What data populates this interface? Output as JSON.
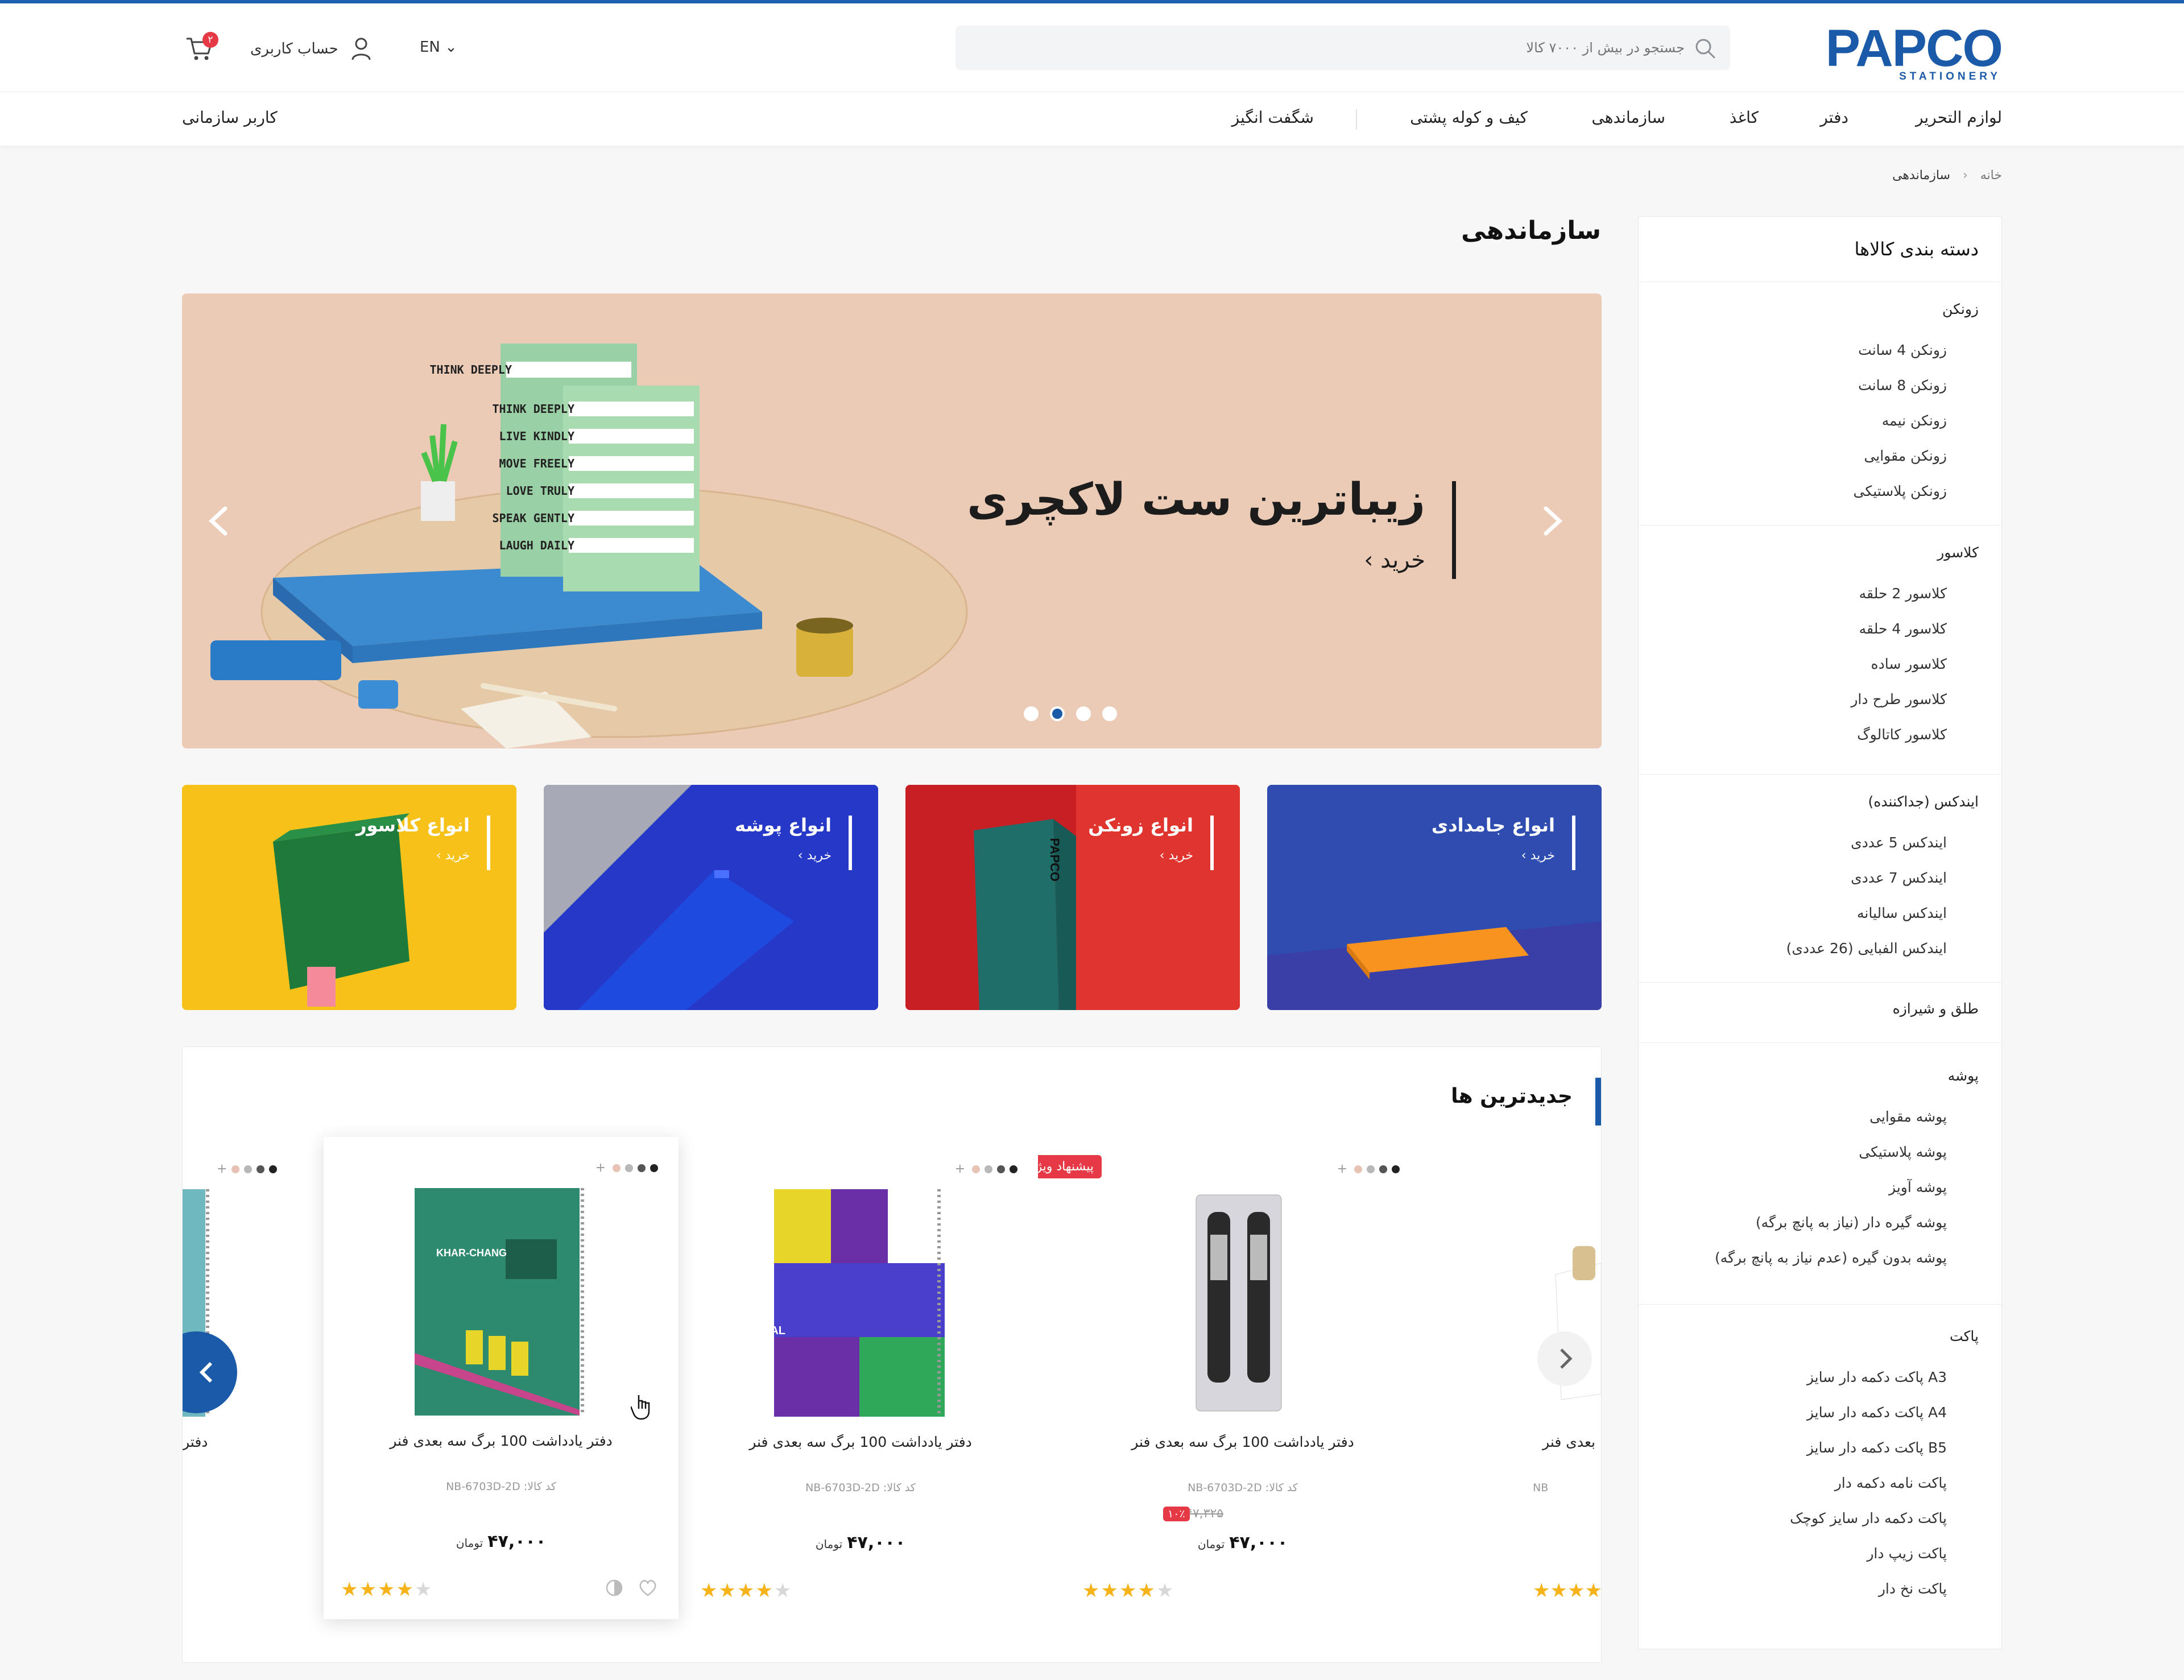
{
  "brand": {
    "name": "PAPCO",
    "tagline": "STATIONERY",
    "color": "#1b5aa8"
  },
  "header": {
    "search_placeholder": "جستجو در بیش از ۷۰۰۰ کالا",
    "lang": "EN ⌄",
    "account": "حساب کاربری",
    "cart_count": "۲"
  },
  "nav": {
    "items": [
      "لوازم التحریر",
      "دفتر",
      "کاغذ",
      "سازماندهی",
      "کیف و کوله پشتی",
      "شگفت انگیز"
    ],
    "org_user": "کاربر سازمانی"
  },
  "breadcrumb": {
    "home": "خانه",
    "current": "سازماندهی"
  },
  "page": {
    "title": "سازماندهی"
  },
  "sidebar": {
    "title": "دسته بندی کالاها",
    "groups": [
      {
        "name": "زونکن",
        "items": [
          "زونکن 4 سانت",
          "زونکن 8 سانت",
          "زونکن نیمه",
          "زونکن مقوایی",
          "زونکن پلاستیکی"
        ]
      },
      {
        "name": "کلاسور",
        "items": [
          "کلاسور 2 حلقه",
          "کلاسور 4 حلقه",
          "کلاسور ساده",
          "کلاسور طرح دار",
          "کلاسور کاتالوگ"
        ]
      },
      {
        "name": "ایندکس (جداکننده)",
        "items": [
          "ایندکس 5 عددی",
          "ایندکس 7 عددی",
          "ایندکس سالیانه",
          "ایندکس الفبایی (26 عددی)"
        ]
      },
      {
        "name": "طلق و شیرازه",
        "items": []
      },
      {
        "name": "پوشه",
        "items": [
          "پوشه مقوایی",
          "پوشه پلاستیکی",
          "پوشه آویز",
          "پوشه گیره دار (نیاز به پانچ برگه)",
          "پوشه بدون گیره (عدم نیاز به پانچ برگه)"
        ]
      },
      {
        "name": "پاکت",
        "items": [
          "A3 پاکت دکمه دار سایز",
          "A4 پاکت دکمه دار سایز",
          "B5 پاکت دکمه دار سایز",
          "پاکت نامه دکمه دار",
          "پاکت دکمه دار سایز کوچک",
          "پاکت زیپ دار",
          "پاکت نخ دار"
        ]
      }
    ]
  },
  "hero": {
    "title": "زیباترین ست لاکچری",
    "cta": "خرید ›",
    "notebook_lines": [
      "THINK DEEPLY",
      "LIVE KINDLY",
      "MOVE FREELY",
      "LOVE TRULY",
      "SPEAK GENTLY",
      "LAUGH DAILY"
    ],
    "slides": 4,
    "active_slide": 2
  },
  "tiles": [
    {
      "title": "انواع جامدادی",
      "cta": "خرید ›",
      "color": "#2d4aa0"
    },
    {
      "title": "انواع زونکن",
      "cta": "خرید ›",
      "color": "#d9262b"
    },
    {
      "title": "انواع پوشه",
      "cta": "خرید ›",
      "color": "#2f3fd0"
    },
    {
      "title": "انواع کلاسور",
      "cta": "خرید ›",
      "color": "#f6c21a"
    }
  ],
  "newest": {
    "title": "جدیدترین ها",
    "products": [
      {
        "name": "دفتر یادداشت 100 برگ سه بعدی فنر",
        "code": "کد کالا: NB-6703D-2D",
        "price": "۴۷,۰۰۰",
        "currency": "تومان",
        "old_price": "۴۷,۳۲۵",
        "discount": "۱۰٪",
        "tag": "پیشنهاد ویژه",
        "rating": 4
      },
      {
        "name": "دفتر یادداشت 100 برگ سه بعدی فنر",
        "code": "کد کالا: NB-6703D-2D",
        "price": "۴۷,۰۰۰",
        "currency": "تومان",
        "rating": 4,
        "cover_text": "ASYMMETRICAL"
      },
      {
        "name": "دفتر یادداشت 100 برگ سه بعدی فنر",
        "code": "کد کالا: NB-6703D-2D",
        "price": "۴۷,۰۰۰",
        "currency": "تومان",
        "rating": 4,
        "cover_text": "KHAR-CHANG"
      }
    ],
    "partial_right": {
      "name": "بعدی فنر",
      "code": "NB"
    },
    "partial_left": {
      "name": "دفتر"
    }
  }
}
